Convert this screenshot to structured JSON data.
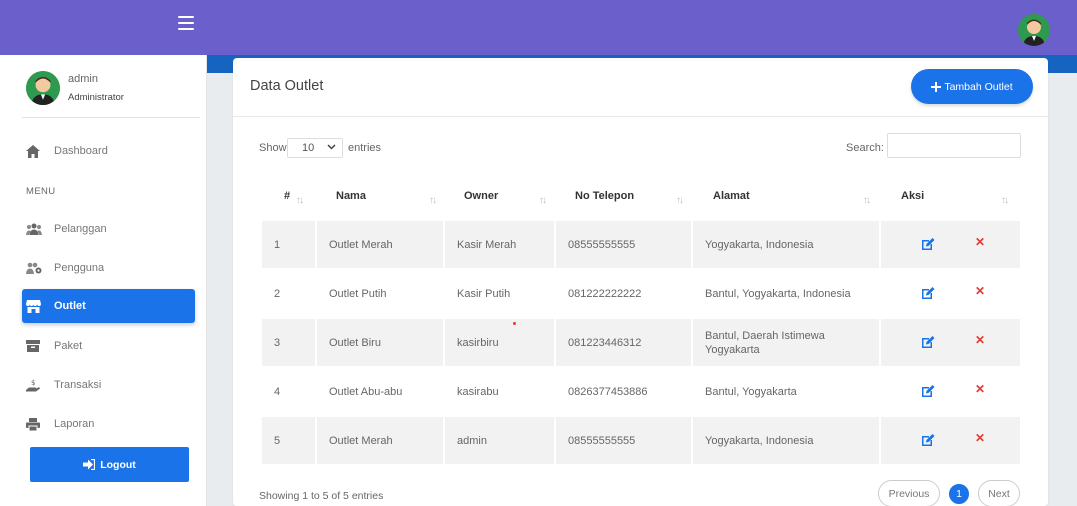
{
  "user": {
    "name": "admin",
    "role": "Administrator"
  },
  "sidebar": {
    "items": [
      {
        "label": "Dashboard",
        "icon": "home-icon"
      },
      {
        "label": "Pelanggan",
        "icon": "users-icon"
      },
      {
        "label": "Pengguna",
        "icon": "user-cog-icon"
      },
      {
        "label": "Outlet",
        "icon": "store-icon",
        "active": true
      },
      {
        "label": "Paket",
        "icon": "box-icon"
      },
      {
        "label": "Transaksi",
        "icon": "hand-coin-icon"
      },
      {
        "label": "Laporan",
        "icon": "printer-icon"
      }
    ],
    "menu_label": "MENU",
    "logout_label": "Logout"
  },
  "page": {
    "title": "Data Outlet",
    "add_button": "Tambah Outlet",
    "show_label": "Show",
    "entries_value": "10",
    "entries_label": "entries",
    "search_label": "Search:",
    "search_value": ""
  },
  "table": {
    "columns": [
      "#",
      "Nama",
      "Owner",
      "No Telepon",
      "Alamat",
      "Aksi"
    ],
    "rows": [
      [
        "1",
        "Outlet Merah",
        "Kasir Merah",
        "08555555555",
        "Yogyakarta, Indonesia"
      ],
      [
        "2",
        "Outlet Putih",
        "Kasir Putih",
        "081222222222",
        "Bantul, Yogyakarta, Indonesia"
      ],
      [
        "3",
        "Outlet Biru",
        "kasirbiru",
        "081223446312",
        "Bantul, Daerah Istimewa Yogyakarta"
      ],
      [
        "4",
        "Outlet Abu-abu",
        "kasirabu",
        "0826377453886",
        "Bantul, Yogyakarta"
      ],
      [
        "5",
        "Outlet Merah",
        "admin",
        "08555555555",
        "Yogyakarta, Indonesia"
      ]
    ]
  },
  "footer": {
    "info": "Showing 1 to 5 of 5 entries",
    "previous": "Previous",
    "current_page": "1",
    "next": "Next"
  },
  "colors": {
    "topbar": "#6a5fcb",
    "primary": "#1a73e8",
    "delete": "#e53935",
    "accent_strip": "#1565c0"
  }
}
